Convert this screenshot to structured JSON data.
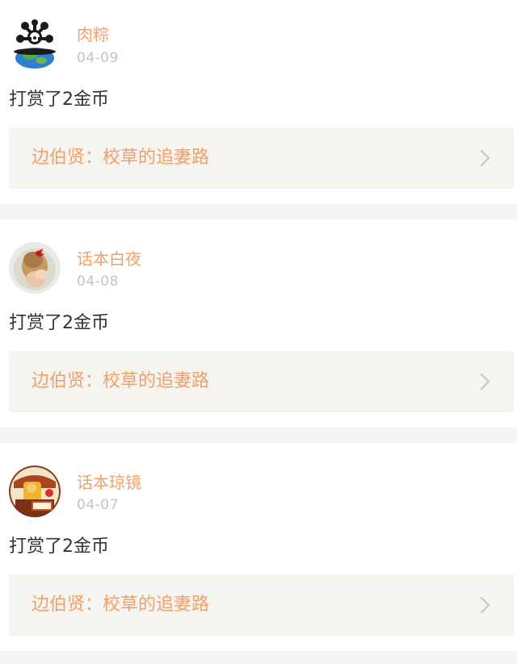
{
  "items": [
    {
      "username": "肉粽",
      "date": "04-09",
      "message": "打赏了2金币",
      "book_label": "边伯贤：校草的追妻路",
      "avatar_icon": "cartoon-globe-avatar"
    },
    {
      "username": "话本白夜",
      "date": "04-08",
      "message": "打赏了2金币",
      "book_label": "边伯贤：校草的追妻路",
      "avatar_icon": "girl-with-red-bow-avatar"
    },
    {
      "username": "话本琼镜",
      "date": "04-07",
      "message": "打赏了2金币",
      "book_label": "边伯贤：校草的追妻路",
      "avatar_icon": "illustrated-avatar"
    }
  ],
  "icons": {
    "chevron": "chevron-right-icon"
  },
  "colors": {
    "accent": "#f0a06c",
    "timestamp": "#c4c4c4",
    "text": "#333333",
    "card_bg": "#ffffff",
    "link_bg": "#f5f4ee",
    "page_bg": "#f5f5f5"
  }
}
